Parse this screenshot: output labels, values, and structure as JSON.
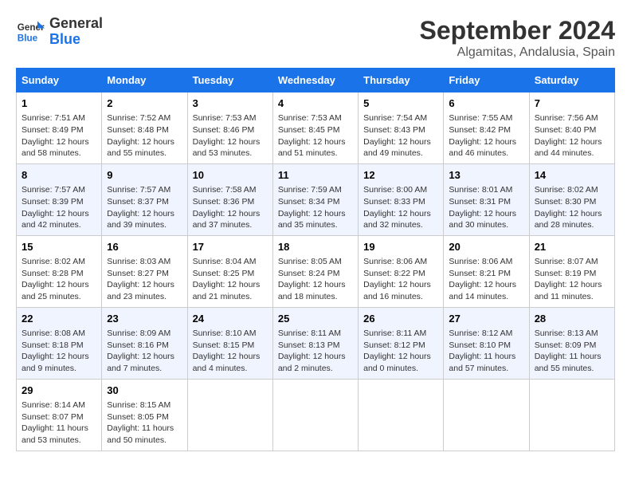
{
  "header": {
    "logo_line1": "General",
    "logo_line2": "Blue",
    "month": "September 2024",
    "location": "Algamitas, Andalusia, Spain"
  },
  "days_of_week": [
    "Sunday",
    "Monday",
    "Tuesday",
    "Wednesday",
    "Thursday",
    "Friday",
    "Saturday"
  ],
  "weeks": [
    [
      {
        "day": "1",
        "lines": [
          "Sunrise: 7:51 AM",
          "Sunset: 8:49 PM",
          "Daylight: 12 hours",
          "and 58 minutes."
        ]
      },
      {
        "day": "2",
        "lines": [
          "Sunrise: 7:52 AM",
          "Sunset: 8:48 PM",
          "Daylight: 12 hours",
          "and 55 minutes."
        ]
      },
      {
        "day": "3",
        "lines": [
          "Sunrise: 7:53 AM",
          "Sunset: 8:46 PM",
          "Daylight: 12 hours",
          "and 53 minutes."
        ]
      },
      {
        "day": "4",
        "lines": [
          "Sunrise: 7:53 AM",
          "Sunset: 8:45 PM",
          "Daylight: 12 hours",
          "and 51 minutes."
        ]
      },
      {
        "day": "5",
        "lines": [
          "Sunrise: 7:54 AM",
          "Sunset: 8:43 PM",
          "Daylight: 12 hours",
          "and 49 minutes."
        ]
      },
      {
        "day": "6",
        "lines": [
          "Sunrise: 7:55 AM",
          "Sunset: 8:42 PM",
          "Daylight: 12 hours",
          "and 46 minutes."
        ]
      },
      {
        "day": "7",
        "lines": [
          "Sunrise: 7:56 AM",
          "Sunset: 8:40 PM",
          "Daylight: 12 hours",
          "and 44 minutes."
        ]
      }
    ],
    [
      {
        "day": "8",
        "lines": [
          "Sunrise: 7:57 AM",
          "Sunset: 8:39 PM",
          "Daylight: 12 hours",
          "and 42 minutes."
        ]
      },
      {
        "day": "9",
        "lines": [
          "Sunrise: 7:57 AM",
          "Sunset: 8:37 PM",
          "Daylight: 12 hours",
          "and 39 minutes."
        ]
      },
      {
        "day": "10",
        "lines": [
          "Sunrise: 7:58 AM",
          "Sunset: 8:36 PM",
          "Daylight: 12 hours",
          "and 37 minutes."
        ]
      },
      {
        "day": "11",
        "lines": [
          "Sunrise: 7:59 AM",
          "Sunset: 8:34 PM",
          "Daylight: 12 hours",
          "and 35 minutes."
        ]
      },
      {
        "day": "12",
        "lines": [
          "Sunrise: 8:00 AM",
          "Sunset: 8:33 PM",
          "Daylight: 12 hours",
          "and 32 minutes."
        ]
      },
      {
        "day": "13",
        "lines": [
          "Sunrise: 8:01 AM",
          "Sunset: 8:31 PM",
          "Daylight: 12 hours",
          "and 30 minutes."
        ]
      },
      {
        "day": "14",
        "lines": [
          "Sunrise: 8:02 AM",
          "Sunset: 8:30 PM",
          "Daylight: 12 hours",
          "and 28 minutes."
        ]
      }
    ],
    [
      {
        "day": "15",
        "lines": [
          "Sunrise: 8:02 AM",
          "Sunset: 8:28 PM",
          "Daylight: 12 hours",
          "and 25 minutes."
        ]
      },
      {
        "day": "16",
        "lines": [
          "Sunrise: 8:03 AM",
          "Sunset: 8:27 PM",
          "Daylight: 12 hours",
          "and 23 minutes."
        ]
      },
      {
        "day": "17",
        "lines": [
          "Sunrise: 8:04 AM",
          "Sunset: 8:25 PM",
          "Daylight: 12 hours",
          "and 21 minutes."
        ]
      },
      {
        "day": "18",
        "lines": [
          "Sunrise: 8:05 AM",
          "Sunset: 8:24 PM",
          "Daylight: 12 hours",
          "and 18 minutes."
        ]
      },
      {
        "day": "19",
        "lines": [
          "Sunrise: 8:06 AM",
          "Sunset: 8:22 PM",
          "Daylight: 12 hours",
          "and 16 minutes."
        ]
      },
      {
        "day": "20",
        "lines": [
          "Sunrise: 8:06 AM",
          "Sunset: 8:21 PM",
          "Daylight: 12 hours",
          "and 14 minutes."
        ]
      },
      {
        "day": "21",
        "lines": [
          "Sunrise: 8:07 AM",
          "Sunset: 8:19 PM",
          "Daylight: 12 hours",
          "and 11 minutes."
        ]
      }
    ],
    [
      {
        "day": "22",
        "lines": [
          "Sunrise: 8:08 AM",
          "Sunset: 8:18 PM",
          "Daylight: 12 hours",
          "and 9 minutes."
        ]
      },
      {
        "day": "23",
        "lines": [
          "Sunrise: 8:09 AM",
          "Sunset: 8:16 PM",
          "Daylight: 12 hours",
          "and 7 minutes."
        ]
      },
      {
        "day": "24",
        "lines": [
          "Sunrise: 8:10 AM",
          "Sunset: 8:15 PM",
          "Daylight: 12 hours",
          "and 4 minutes."
        ]
      },
      {
        "day": "25",
        "lines": [
          "Sunrise: 8:11 AM",
          "Sunset: 8:13 PM",
          "Daylight: 12 hours",
          "and 2 minutes."
        ]
      },
      {
        "day": "26",
        "lines": [
          "Sunrise: 8:11 AM",
          "Sunset: 8:12 PM",
          "Daylight: 12 hours",
          "and 0 minutes."
        ]
      },
      {
        "day": "27",
        "lines": [
          "Sunrise: 8:12 AM",
          "Sunset: 8:10 PM",
          "Daylight: 11 hours",
          "and 57 minutes."
        ]
      },
      {
        "day": "28",
        "lines": [
          "Sunrise: 8:13 AM",
          "Sunset: 8:09 PM",
          "Daylight: 11 hours",
          "and 55 minutes."
        ]
      }
    ],
    [
      {
        "day": "29",
        "lines": [
          "Sunrise: 8:14 AM",
          "Sunset: 8:07 PM",
          "Daylight: 11 hours",
          "and 53 minutes."
        ]
      },
      {
        "day": "30",
        "lines": [
          "Sunrise: 8:15 AM",
          "Sunset: 8:05 PM",
          "Daylight: 11 hours",
          "and 50 minutes."
        ]
      },
      {
        "day": "",
        "lines": []
      },
      {
        "day": "",
        "lines": []
      },
      {
        "day": "",
        "lines": []
      },
      {
        "day": "",
        "lines": []
      },
      {
        "day": "",
        "lines": []
      }
    ]
  ]
}
